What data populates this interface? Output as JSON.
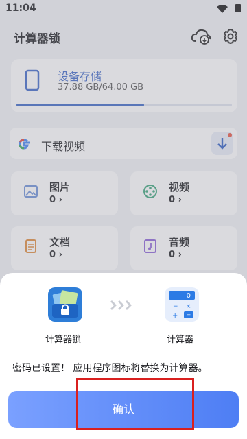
{
  "status_bar": {
    "time": "11:04"
  },
  "app": {
    "title": "计算器锁"
  },
  "storage": {
    "title": "设备存储",
    "size": "37.88 GB/64.00 GB",
    "used_fraction": 0.592
  },
  "download": {
    "label": "下载视频"
  },
  "categories": [
    {
      "label": "图片",
      "count": "0",
      "icon": "image-icon"
    },
    {
      "label": "视频",
      "count": "0",
      "icon": "film-reel-icon"
    },
    {
      "label": "文档",
      "count": "0",
      "icon": "document-icon"
    },
    {
      "label": "音频",
      "count": "0",
      "icon": "music-note-icon"
    }
  ],
  "dialog": {
    "old_app_name": "计算器锁",
    "new_app_name": "计算器",
    "message": "密码已设置！ 应用程序图标将替换为计算器。",
    "confirm_label": "确认"
  },
  "colors": {
    "accent": "#3a66c5",
    "button_start": "#7aa0ff",
    "button_end": "#4e7ef4",
    "highlight": "#d9201f"
  }
}
